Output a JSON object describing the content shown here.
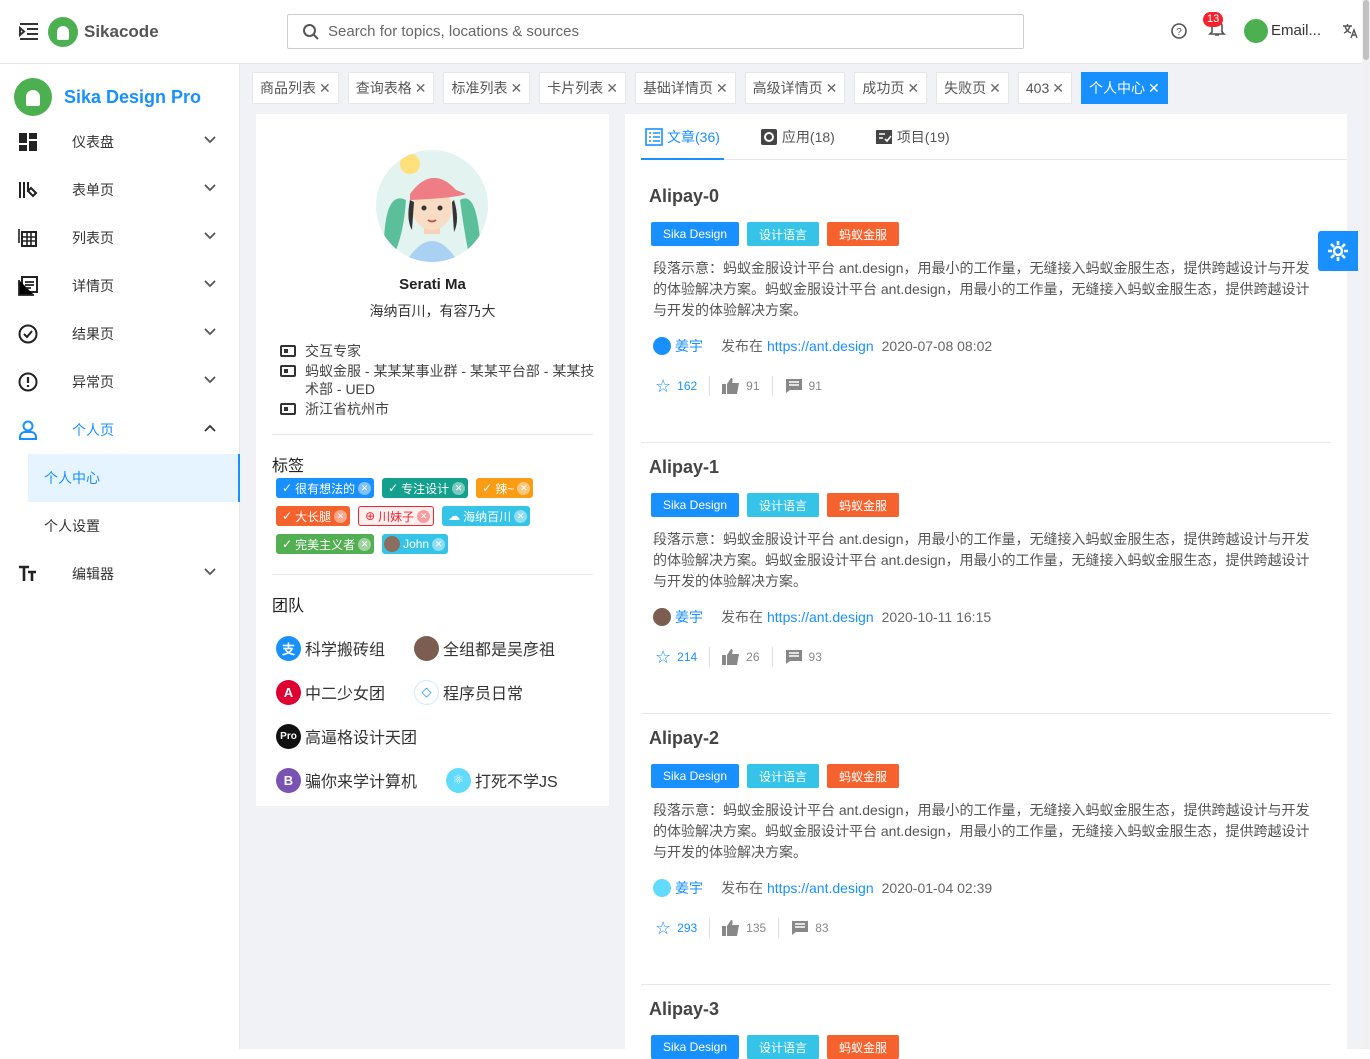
{
  "header": {
    "brand": "Sikacode",
    "search_placeholder": "Search for topics, locations & sources",
    "notification_count": "13",
    "user_label": "Email..."
  },
  "sidebar": {
    "title": "Sika Design Pro",
    "items": [
      {
        "label": "仪表盘",
        "icon": "dashboard-icon"
      },
      {
        "label": "表单页",
        "icon": "form-icon"
      },
      {
        "label": "列表页",
        "icon": "table-icon"
      },
      {
        "label": "详情页",
        "icon": "profile-icon"
      },
      {
        "label": "结果页",
        "icon": "check-circle-icon"
      },
      {
        "label": "异常页",
        "icon": "warning-icon"
      },
      {
        "label": "个人页",
        "icon": "user-icon"
      },
      {
        "label": "编辑器",
        "icon": "font-size-icon"
      }
    ],
    "sub_items": [
      "个人中心",
      "个人设置"
    ]
  },
  "tabs": [
    "商品列表",
    "查询表格",
    "标准列表",
    "卡片列表",
    "基础详情页",
    "高级详情页",
    "成功页",
    "失败页",
    "403",
    "个人中心"
  ],
  "profile": {
    "name": "Serati Ma",
    "motto": "海纳百川，有容乃大",
    "title": "交互专家",
    "org": "蚂蚁金服 - 某某某事业群 - 某某平台部 - 某某技术部 - UED",
    "location": "浙江省杭州市",
    "tags_heading": "标签",
    "tags": [
      {
        "label": "很有想法的",
        "color": "#1890ff"
      },
      {
        "label": "专注设计",
        "color": "#13a08c"
      },
      {
        "label": "辣~",
        "color": "#fa9c14"
      },
      {
        "label": "大长腿",
        "color": "#f5622d"
      },
      {
        "label": "川妹子",
        "color": "#f5222d"
      },
      {
        "label": "海纳百川",
        "color": "#36c3e8"
      },
      {
        "label": "完美主义者",
        "color": "#52b052"
      },
      {
        "label": "John",
        "color": "#36c3e8"
      }
    ],
    "team_heading": "团队",
    "teams": [
      "科学搬砖组",
      "全组都是吴彦祖",
      "中二少女团",
      "程序员日常",
      "高逼格设计天团",
      "骗你来学计算机",
      "打死不学JS"
    ]
  },
  "article_tabs": [
    {
      "label": "文章(36)",
      "icon": "list-icon"
    },
    {
      "label": "应用(18)",
      "icon": "app-icon"
    },
    {
      "label": "项目(19)",
      "icon": "project-icon"
    }
  ],
  "articles": [
    {
      "title": "Alipay-0",
      "tags": [
        "Sika Design",
        "设计语言",
        "蚂蚁金服"
      ],
      "desc": "段落示意：蚂蚁金服设计平台 ant.design，用最小的工作量，无缝接入蚂蚁金服生态，提供跨越设计与开发的体验解决方案。蚂蚁金服设计平台 ant.design，用最小的工作量，无缝接入蚂蚁金服生态，提供跨越设计与开发的体验解决方案。",
      "author": "姜宇",
      "published": "发布在",
      "link": "https://ant.design",
      "date": "2020-07-08 08:02",
      "stars": "162",
      "likes": "91",
      "comments": "91"
    },
    {
      "title": "Alipay-1",
      "tags": [
        "Sika Design",
        "设计语言",
        "蚂蚁金服"
      ],
      "desc": "段落示意：蚂蚁金服设计平台 ant.design，用最小的工作量，无缝接入蚂蚁金服生态，提供跨越设计与开发的体验解决方案。蚂蚁金服设计平台 ant.design，用最小的工作量，无缝接入蚂蚁金服生态，提供跨越设计与开发的体验解决方案。",
      "author": "姜宇",
      "published": "发布在",
      "link": "https://ant.design",
      "date": "2020-10-11 16:15",
      "stars": "214",
      "likes": "26",
      "comments": "93"
    },
    {
      "title": "Alipay-2",
      "tags": [
        "Sika Design",
        "设计语言",
        "蚂蚁金服"
      ],
      "desc": "段落示意：蚂蚁金服设计平台 ant.design，用最小的工作量，无缝接入蚂蚁金服生态，提供跨越设计与开发的体验解决方案。蚂蚁金服设计平台 ant.design，用最小的工作量，无缝接入蚂蚁金服生态，提供跨越设计与开发的体验解决方案。",
      "author": "姜宇",
      "published": "发布在",
      "link": "https://ant.design",
      "date": "2020-01-04 02:39",
      "stars": "293",
      "likes": "135",
      "comments": "83"
    },
    {
      "title": "Alipay-3",
      "tags": [
        "Sika Design",
        "设计语言",
        "蚂蚁金服"
      ]
    }
  ],
  "colors": {
    "accent": "#1890ff",
    "tag_blue": "#1890ff",
    "tag_cyan": "#36c3e8",
    "tag_orange": "#f5622d"
  }
}
